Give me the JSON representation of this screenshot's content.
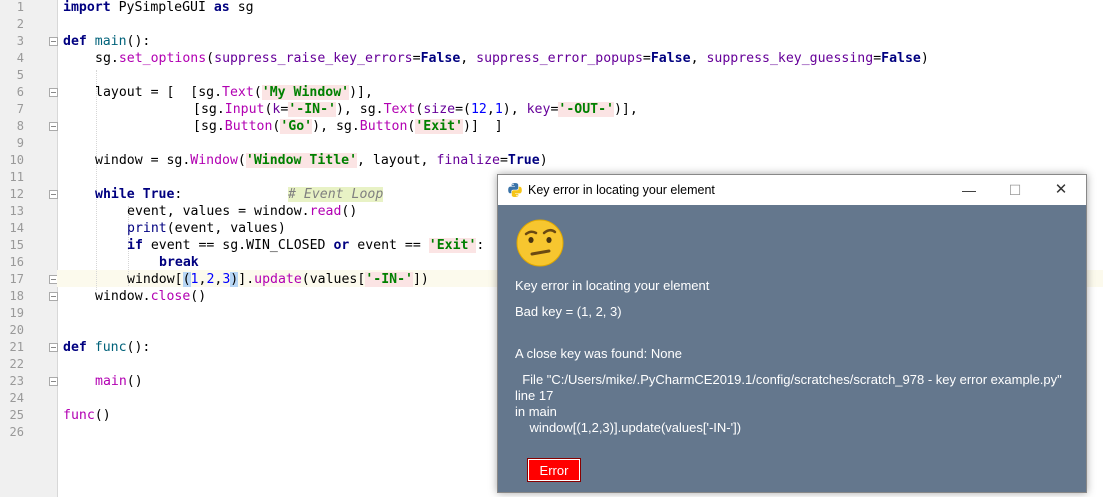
{
  "editor": {
    "lines": [
      "1",
      "2",
      "3",
      "4",
      "5",
      "6",
      "7",
      "8",
      "9",
      "10",
      "11",
      "12",
      "13",
      "14",
      "15",
      "16",
      "17",
      "18",
      "19",
      "20",
      "21",
      "22",
      "23",
      "24",
      "25",
      "26"
    ],
    "code": {
      "l1_import": "import",
      "l1_rest": " PySimpleGUI ",
      "l1_as": "as",
      "l1_sg": " sg",
      "l3_def": "def",
      "l3_name": " main",
      "l3_rest": "():",
      "l4_a": "sg.",
      "l4_call": "set_options",
      "l4_b": "(",
      "l4_k1": "suppress_raise_key_errors",
      "l4_eq1": "=",
      "l4_v1": "False",
      "l4_c1": ", ",
      "l4_k2": "suppress_error_popups",
      "l4_eq2": "=",
      "l4_v2": "False",
      "l4_c2": ", ",
      "l4_k3": "suppress_key_guessing",
      "l4_eq3": "=",
      "l4_v3": "False",
      "l4_end": ")",
      "l6_a": "layout = [  [sg.",
      "l6_call": "Text",
      "l6_b": "(",
      "l6_s": "'My Window'",
      "l6_end": ")],",
      "l7_a": "[sg.",
      "l7_call1": "Input",
      "l7_b": "(",
      "l7_k": "k",
      "l7_c": "=",
      "l7_s": "'-IN-'",
      "l7_d": "), sg.",
      "l7_call2": "Text",
      "l7_e": "(",
      "l7_k2": "size",
      "l7_f": "=(",
      "l7_n1": "12",
      "l7_g": ",",
      "l7_n2": "1",
      "l7_h": "), ",
      "l7_k3": "key",
      "l7_i": "=",
      "l7_s2": "'-OUT-'",
      "l7_end": ")],",
      "l8_a": "[sg.",
      "l8_call1": "Button",
      "l8_b": "(",
      "l8_s1": "'Go'",
      "l8_c": "), sg.",
      "l8_call2": "Button",
      "l8_d": "(",
      "l8_s2": "'Exit'",
      "l8_end": ")]  ]",
      "l10_a": "window = sg.",
      "l10_call": "Window",
      "l10_b": "(",
      "l10_s": "'Window Title'",
      "l10_c": ", layout, ",
      "l10_k": "finalize",
      "l10_d": "=",
      "l10_v": "True",
      "l10_end": ")",
      "l12_kw": "while",
      "l12_v": " True",
      "l12_c": ":",
      "l12_cm": "# Event Loop",
      "l13_a": "event, values = window.",
      "l13_call": "read",
      "l13_end": "()",
      "l14_fn": "print",
      "l14_end": "(event, values)",
      "l15_kw": "if",
      "l15_a": " event == sg.WIN_CLOSED ",
      "l15_or": "or",
      "l15_b": " event == ",
      "l15_s": "'Exit'",
      "l15_end": ":",
      "l16_kw": "break",
      "l17_a": "window[",
      "l17_p1": "(",
      "l17_n1": "1",
      "l17_c1": ",",
      "l17_n2": "2",
      "l17_c2": ",",
      "l17_n3": "3",
      "l17_p2": ")",
      "l17_b": "].",
      "l17_call": "update",
      "l17_c": "(values[",
      "l17_s": "'-IN-'",
      "l17_end": "])",
      "l18_a": "window.",
      "l18_call": "close",
      "l18_end": "()",
      "l21_def": "def",
      "l21_name": " func",
      "l21_rest": "():",
      "l23_a": "main",
      "l23_end": "()",
      "l25_a": "func",
      "l25_end": "()"
    }
  },
  "popup": {
    "title": "Key error in locating your element",
    "minimize": "—",
    "maximize": "☐",
    "close": "✕",
    "emoji": "🤨",
    "heading": "Key error in locating your element",
    "bad_key": "Bad key = (1, 2, 3)",
    "close_key": "A close key was found: None",
    "tb_file": "  File \"C:/Users/mike/.PyCharmCE2019.1/config/scratches/scratch_978 - key error example.py\"",
    "tb_line": "line 17",
    "tb_in": "in main",
    "tb_code": "    window[(1,2,3)].update(values['-IN-'])",
    "button": "Error"
  },
  "colors": {
    "popup_bg": "#64778d",
    "error_button": "#ff0000",
    "keyword": "#000080",
    "string": "#008000",
    "call": "#b200b2",
    "kwarg": "#660099",
    "number": "#0000ff"
  }
}
